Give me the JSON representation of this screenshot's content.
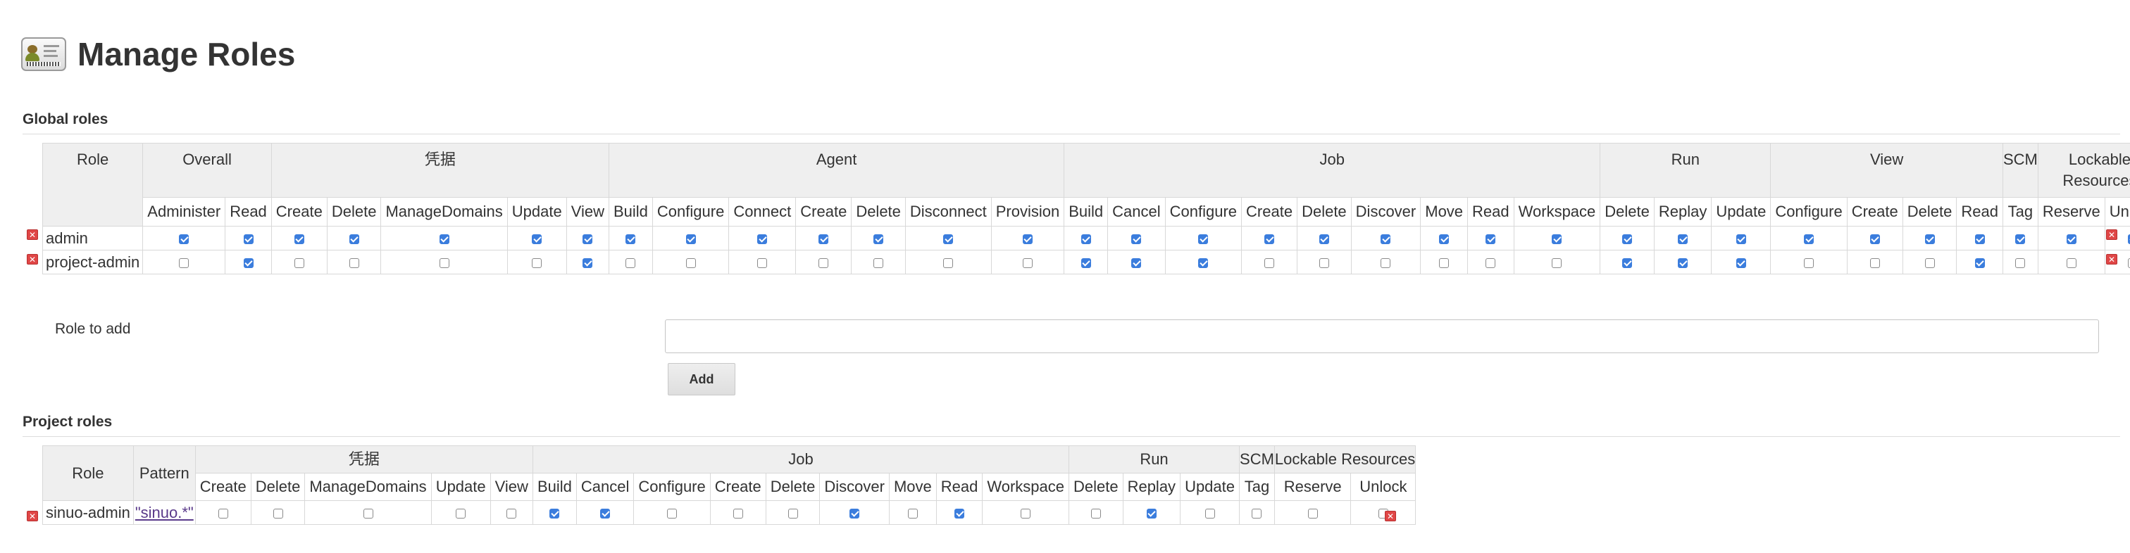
{
  "page": {
    "title": "Manage Roles",
    "global_heading": "Global roles",
    "project_heading": "Project roles"
  },
  "colors": {
    "checkbox_checked": "#3b7ddd",
    "header_bg": "#efefef",
    "delete_icon": "#e04646"
  },
  "global_roles": {
    "role_header": "Role",
    "groups": [
      {
        "name": "Overall",
        "permissions": [
          "Administer",
          "Read"
        ]
      },
      {
        "name": "凭据",
        "permissions": [
          "Create",
          "Delete",
          "ManageDomains",
          "Update",
          "View"
        ]
      },
      {
        "name": "Agent",
        "permissions": [
          "Build",
          "Configure",
          "Connect",
          "Create",
          "Delete",
          "Disconnect",
          "Provision"
        ]
      },
      {
        "name": "Job",
        "permissions": [
          "Build",
          "Cancel",
          "Configure",
          "Create",
          "Delete",
          "Discover",
          "Move",
          "Read",
          "Workspace"
        ]
      },
      {
        "name": "Run",
        "permissions": [
          "Delete",
          "Replay",
          "Update"
        ]
      },
      {
        "name": "View",
        "permissions": [
          "Configure",
          "Create",
          "Delete",
          "Read"
        ]
      },
      {
        "name": "SCM",
        "permissions": [
          "Tag"
        ]
      },
      {
        "name": "Lockable Resources",
        "permissions": [
          "Reserve",
          "Unlock"
        ]
      }
    ],
    "rows": [
      {
        "name": "admin",
        "checks": [
          1,
          1,
          1,
          1,
          1,
          1,
          1,
          1,
          1,
          1,
          1,
          1,
          1,
          1,
          1,
          1,
          1,
          1,
          1,
          1,
          1,
          1,
          1,
          1,
          1,
          1,
          1,
          1,
          1,
          1,
          1,
          1,
          1
        ]
      },
      {
        "name": "project-admin",
        "checks": [
          0,
          1,
          0,
          0,
          0,
          0,
          1,
          0,
          0,
          0,
          0,
          0,
          0,
          0,
          1,
          1,
          1,
          0,
          0,
          0,
          0,
          0,
          0,
          1,
          1,
          1,
          0,
          0,
          0,
          1,
          0,
          0,
          0
        ]
      }
    ]
  },
  "role_to_add": {
    "label": "Role to add",
    "value": "",
    "button_label": "Add"
  },
  "project_roles": {
    "role_header": "Role",
    "pattern_header": "Pattern",
    "groups": [
      {
        "name": "凭据",
        "permissions": [
          "Create",
          "Delete",
          "ManageDomains",
          "Update",
          "View"
        ]
      },
      {
        "name": "Job",
        "permissions": [
          "Build",
          "Cancel",
          "Configure",
          "Create",
          "Delete",
          "Discover",
          "Move",
          "Read",
          "Workspace"
        ]
      },
      {
        "name": "Run",
        "permissions": [
          "Delete",
          "Replay",
          "Update"
        ]
      },
      {
        "name": "SCM",
        "permissions": [
          "Tag"
        ]
      },
      {
        "name": "Lockable Resources",
        "permissions": [
          "Reserve",
          "Unlock"
        ]
      }
    ],
    "rows": [
      {
        "name": "sinuo-admin",
        "pattern": "\"sinuo.*\"",
        "checks": [
          0,
          0,
          0,
          0,
          0,
          1,
          1,
          0,
          0,
          0,
          1,
          0,
          1,
          0,
          0,
          1,
          0,
          0,
          0,
          0
        ]
      }
    ]
  }
}
